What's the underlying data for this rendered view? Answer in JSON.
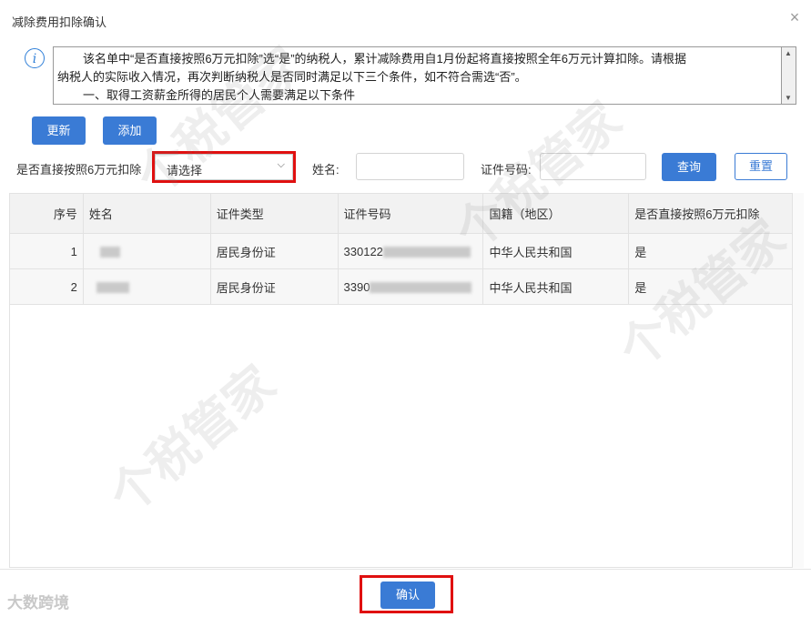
{
  "dialog": {
    "title": "减除费用扣除确认",
    "close_symbol": "×"
  },
  "notice": {
    "lines": [
      "该名单中“是否直接按照6万元扣除”选“是”的纳税人，累计减除费用自1月份起将直接按照全年6万元计算扣除。请根据",
      "纳税人的实际收入情况，再次判断纳税人是否同时满足以下三个条件，如不符合需选“否”。",
      "一、取得工资薪金所得的居民个人需要满足以下条件"
    ]
  },
  "toolbar": {
    "update_label": "更新",
    "add_label": "添加"
  },
  "filters": {
    "deduct_label": "是否直接按照6万元扣除",
    "deduct_value": "请选择",
    "name_label": "姓名:",
    "name_value": "",
    "id_label": "证件号码:",
    "id_value": "",
    "query_label": "查询",
    "reset_label": "重置"
  },
  "table": {
    "headers": [
      "序号",
      "姓名",
      "证件类型",
      "证件号码",
      "国籍（地区）",
      "是否直接按照6万元扣除"
    ],
    "rows": [
      {
        "index": "1",
        "id_type": "居民身份证",
        "id_prefix": "330122",
        "nationality": "中华人民共和国",
        "deduct": "是"
      },
      {
        "index": "2",
        "id_type": "居民身份证",
        "id_prefix": "3390",
        "nationality": "中华人民共和国",
        "deduct": "是"
      }
    ]
  },
  "footer": {
    "confirm_label": "确认",
    "brand": "大数跨境"
  },
  "watermark": "个税管家",
  "colors": {
    "primary": "#3a7bd5",
    "highlight_border": "#e01010",
    "header_bg": "#f2f2f2"
  }
}
